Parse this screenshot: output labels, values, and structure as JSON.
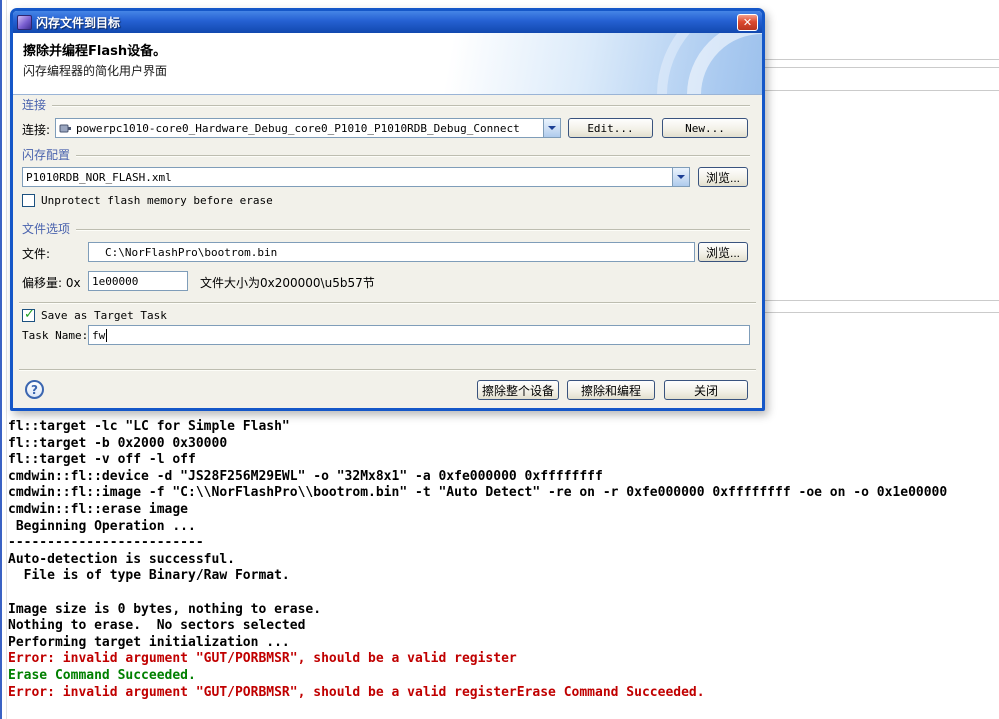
{
  "dialog": {
    "title": "闪存文件到目标",
    "close_glyph": "✕",
    "header": {
      "title": "擦除并编程Flash设备。",
      "subtitle": "闪存编程器的简化用户界面"
    },
    "connection": {
      "section_label": "连接",
      "field_label": "连接:",
      "combo_value": "powerpc1010-core0_Hardware_Debug_core0_P1010_P1010RDB_Debug_Connect",
      "edit_button": "Edit...",
      "new_button": "New..."
    },
    "flash_config": {
      "section_label": "闪存配置",
      "combo_value": "P1010RDB_NOR_FLASH.xml",
      "browse_button": "浏览...",
      "unprotect_label": "Unprotect flash memory before erase",
      "unprotect_checked": false
    },
    "file_options": {
      "section_label": "文件选项",
      "file_label": "文件:",
      "file_value": "C:\\NorFlashPro\\bootrom.bin",
      "browse_button": "浏览...",
      "offset_label": "偏移量: 0x",
      "offset_value": "1e00000",
      "size_note": "文件大小为0x200000\\u5b57节"
    },
    "task": {
      "save_label": "Save as Target Task",
      "save_checked": true,
      "name_label": "Task Name:",
      "name_value": "fw"
    },
    "footer": {
      "help_glyph": "?",
      "erase_device_button": "擦除整个设备",
      "erase_program_button": "擦除和编程",
      "close_button": "关闭"
    }
  },
  "colors": {
    "error_text": "#c00000",
    "success_text": "#008000",
    "section_label": "#4a63ae",
    "titlebar_blue": "#1148ae",
    "close_red": "#dd4a30"
  },
  "console": {
    "lines": [
      {
        "text": "fl::target -lc \"LC for Simple Flash\"",
        "type": "cmd"
      },
      {
        "text": "fl::target -b 0x2000 0x30000",
        "type": "cmd"
      },
      {
        "text": "fl::target -v off -l off",
        "type": "cmd"
      },
      {
        "text": "cmdwin::fl::device -d \"JS28F256M29EWL\" -o \"32Mx8x1\" -a 0xfe000000 0xffffffff",
        "type": "cmd"
      },
      {
        "text": "cmdwin::fl::image -f \"C:\\\\NorFlashPro\\\\bootrom.bin\" -t \"Auto Detect\" -re on -r 0xfe000000 0xffffffff -oe on -o 0x1e00000",
        "type": "cmd"
      },
      {
        "text": "cmdwin::fl::erase image",
        "type": "cmd"
      },
      {
        "text": " Beginning Operation ...",
        "type": "out"
      },
      {
        "text": "-------------------------",
        "type": "out"
      },
      {
        "text": "Auto-detection is successful.",
        "type": "out"
      },
      {
        "text": "  File is of type Binary/Raw Format.",
        "type": "out"
      },
      {
        "text": "",
        "type": "out"
      },
      {
        "text": "Image size is 0 bytes, nothing to erase.",
        "type": "out"
      },
      {
        "text": "Nothing to erase.  No sectors selected",
        "type": "out"
      },
      {
        "text": "Performing target initialization ...",
        "type": "out"
      },
      {
        "text": "Error: invalid argument \"GUT/PORBMSR\", should be a valid register",
        "type": "error"
      },
      {
        "text": "Erase Command Succeeded.",
        "type": "success"
      },
      {
        "text": "Error: invalid argument \"GUT/PORBMSR\", should be a valid registerErase Command Succeeded.",
        "type": "error"
      }
    ]
  }
}
